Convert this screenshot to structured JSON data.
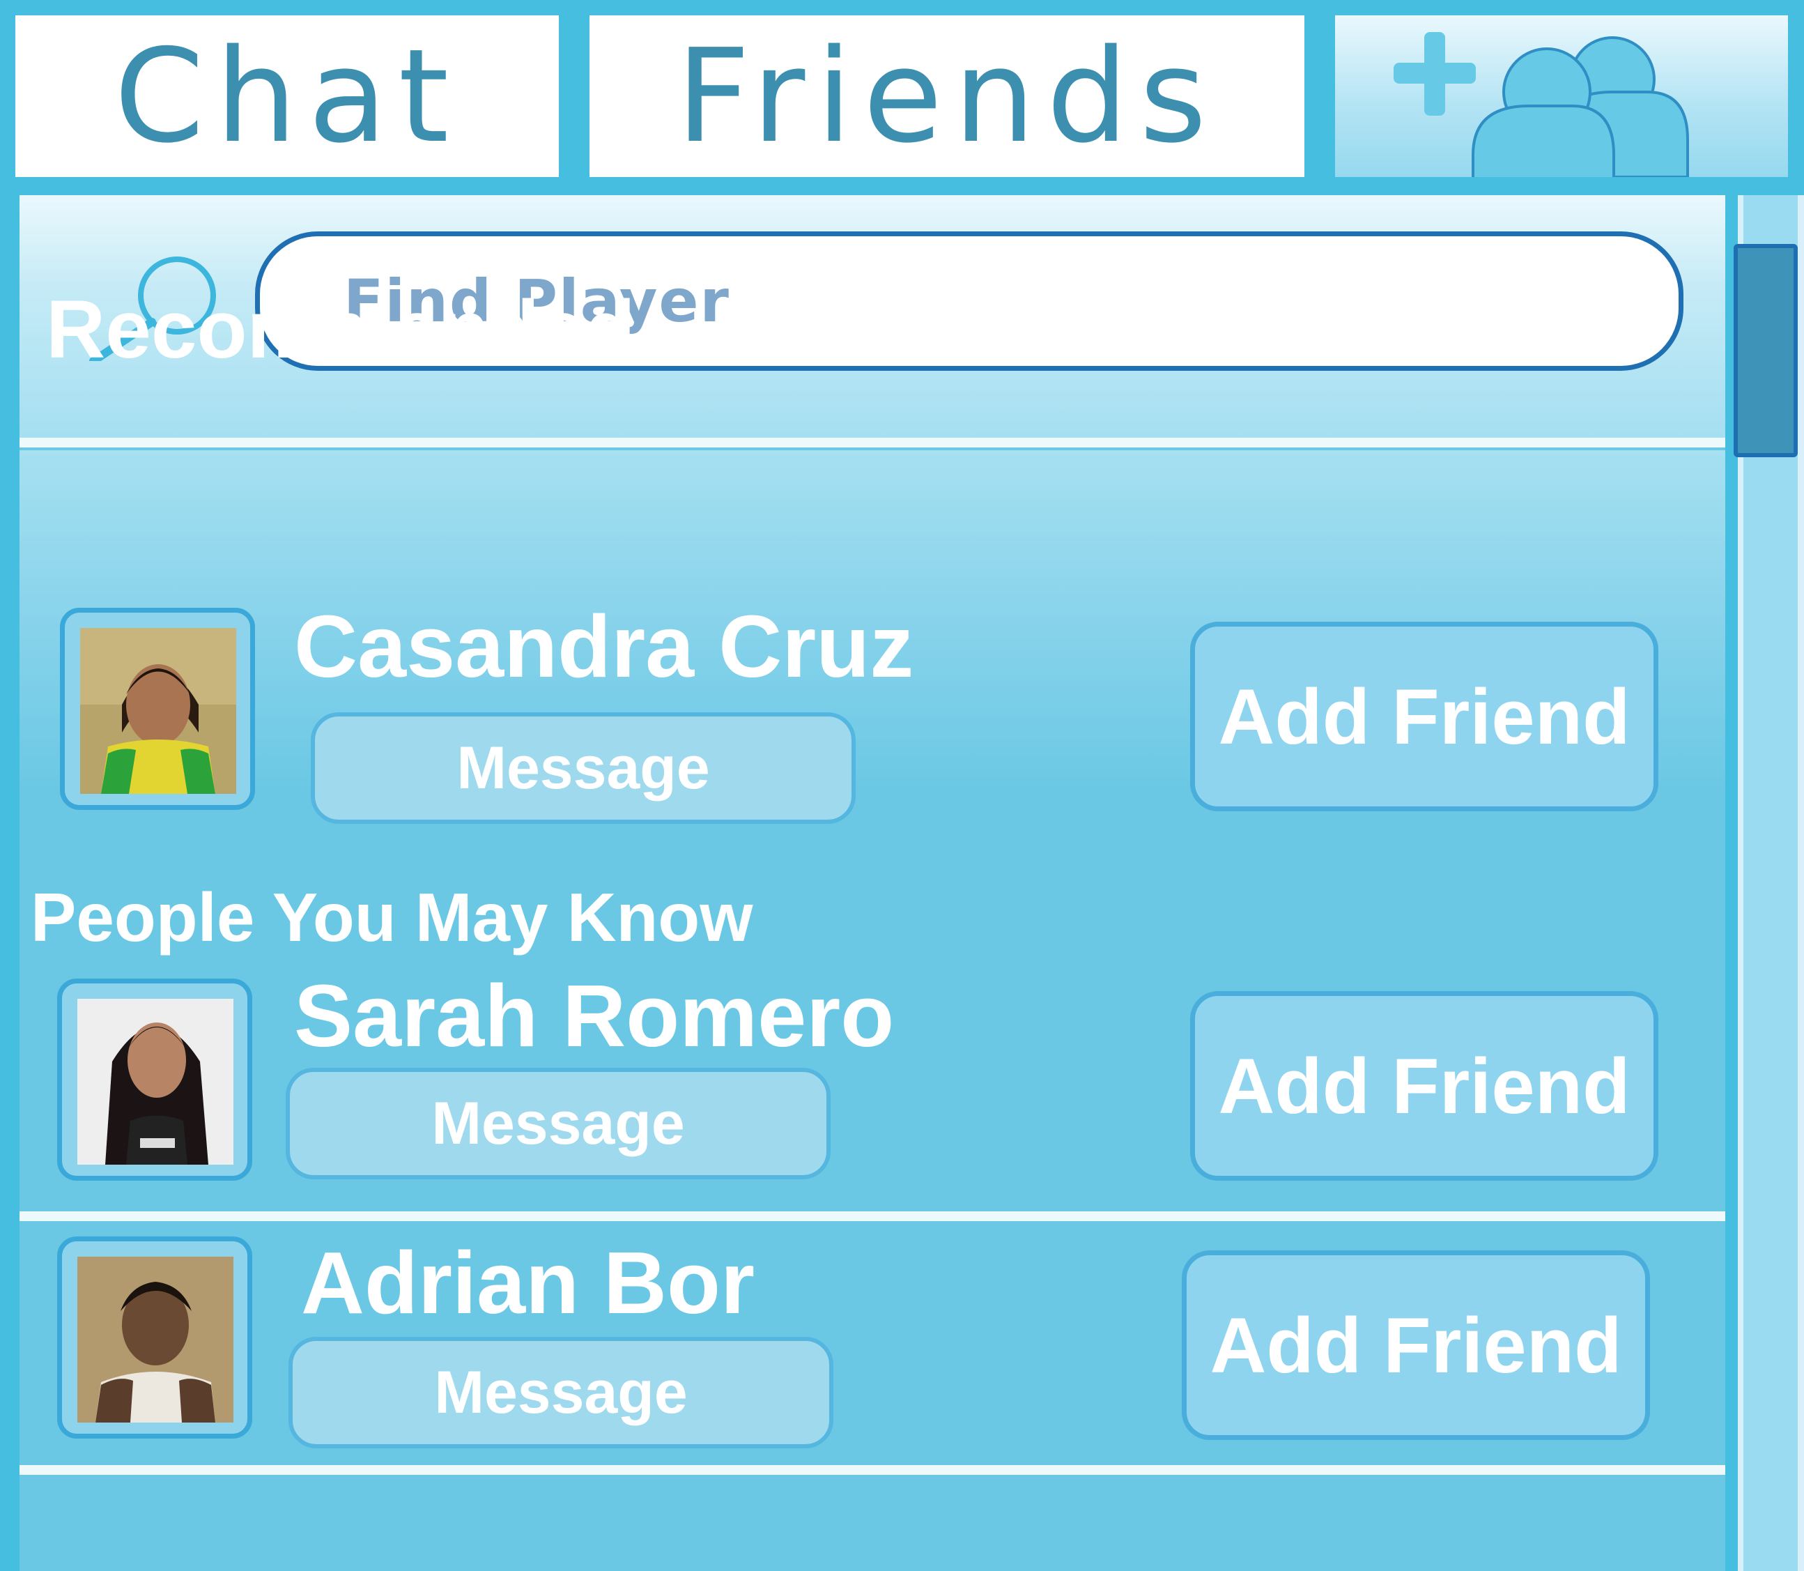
{
  "tabs": {
    "chat_label": "Chat",
    "friends_label": "Friends",
    "add_friend_icon": "add-user-icon"
  },
  "search": {
    "placeholder": "Find Player",
    "icon": "search-icon"
  },
  "sections": {
    "recommended_title": "Recommended",
    "people_title": "People You May Know"
  },
  "people": [
    {
      "name": "Casandra Cruz",
      "message_label": "Message",
      "add_label": "Add Friend"
    },
    {
      "name": "Sarah Romero",
      "message_label": "Message",
      "add_label": "Add Friend"
    },
    {
      "name": "Adrian Bor",
      "message_label": "Message",
      "add_label": "Add Friend"
    }
  ],
  "colors": {
    "frame": "#45bee0",
    "panel": "#6ac8e4",
    "tab_text": "#3d8fb0",
    "search_border": "#1f6fb3",
    "scroll_thumb": "#3e93b8"
  }
}
